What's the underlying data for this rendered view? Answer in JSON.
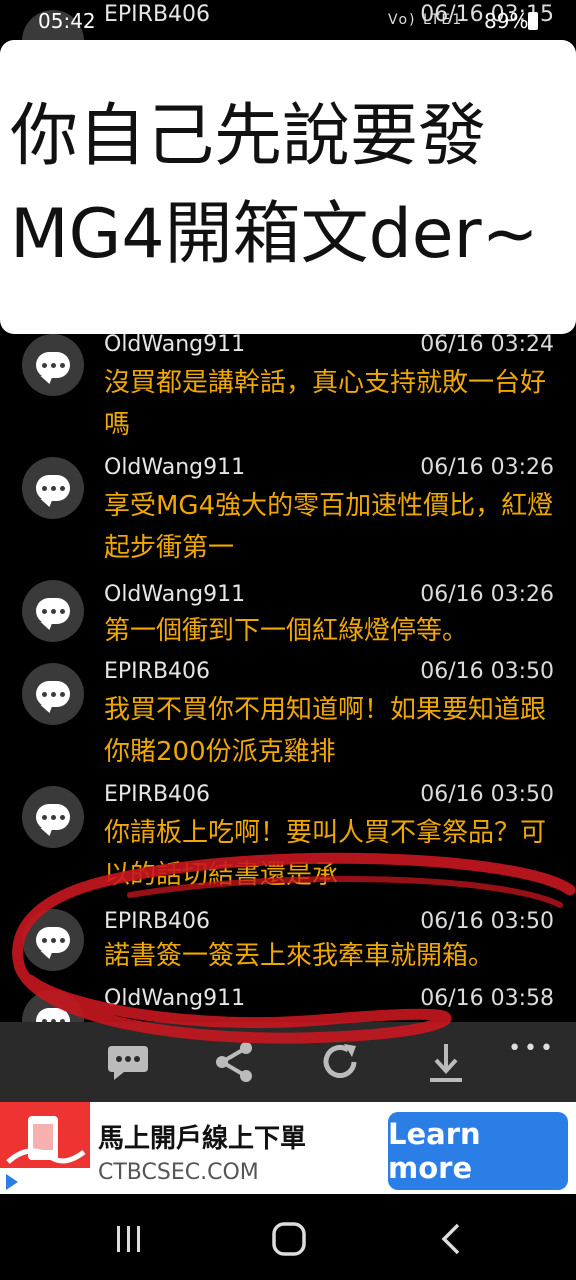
{
  "status_bar": {
    "time": "05:42",
    "icons": "Vo) LTE1",
    "battery": "89%"
  },
  "top_row": {
    "author": "EPIRB406",
    "time": "06/16 03:15"
  },
  "overlay": {
    "text": "你自己先說要發\nMG4開箱文der~"
  },
  "posts": [
    {
      "author": "OldWang911",
      "time": "06/16 03:24",
      "text": "沒買都是講幹話，真心支持就敗一台好嗎"
    },
    {
      "author": "OldWang911",
      "time": "06/16 03:26",
      "text": "享受MG4強大的零百加速性價比，紅燈起步衝第一"
    },
    {
      "author": "OldWang911",
      "time": "06/16 03:26",
      "text": "第一個衝到下一個紅綠燈停等。"
    },
    {
      "author": "EPIRB406",
      "time": "06/16 03:50",
      "text": "我買不買你不用知道啊！如果要知道跟你賭200份派克雞排"
    },
    {
      "author": "EPIRB406",
      "time": "06/16 03:50",
      "text": "你請板上吃啊！要叫人買不拿祭品？可以的話切結書還是承"
    },
    {
      "author": "EPIRB406",
      "time": "06/16 03:50",
      "text": "諾書簽一簽丟上來我牽車就開箱。"
    },
    {
      "author": "OldWang911",
      "time": "06/16 03:58",
      "text": ""
    }
  ],
  "toolbar": {
    "more": "•••"
  },
  "ad": {
    "title": "馬上開戶線上下單",
    "url": "CTBCSEC.COM",
    "button": "Learn more"
  },
  "colors": {
    "message": "#f0a800",
    "ad_button": "#2a7ee6",
    "scribble": "#c8161e"
  }
}
